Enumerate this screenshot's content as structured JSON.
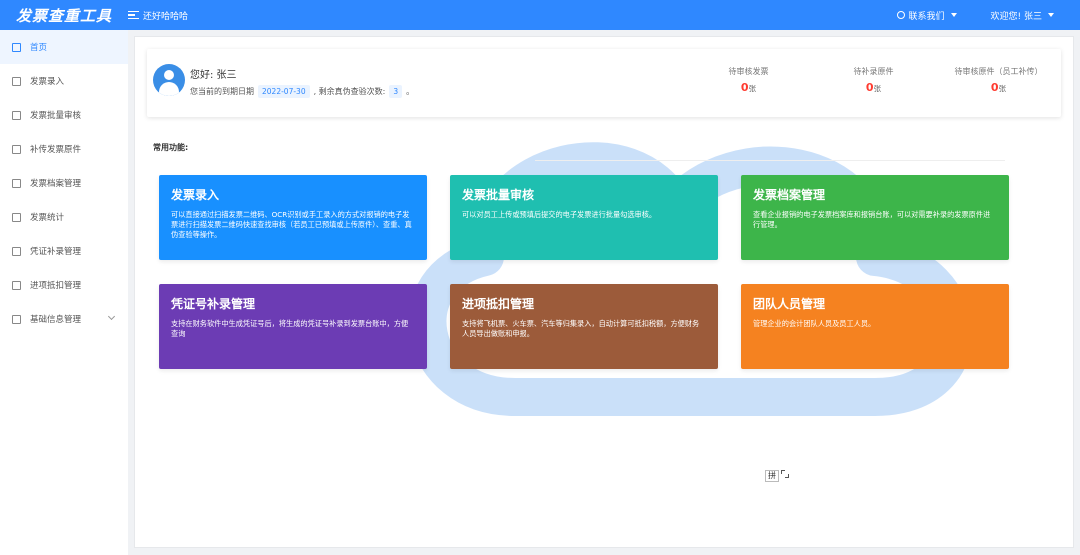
{
  "header": {
    "logo": "发票查重工具",
    "menu_label": "还好哈哈哈",
    "contact_label": "联系我们",
    "welcome_label": "欢迎您! 张三"
  },
  "sidebar": {
    "items": [
      {
        "label": "首页",
        "icon": "home-icon"
      },
      {
        "label": "发票录入",
        "icon": "entry-icon"
      },
      {
        "label": "发票批量审核",
        "icon": "batch-icon"
      },
      {
        "label": "补传发票原件",
        "icon": "upload-icon"
      },
      {
        "label": "发票档案管理",
        "icon": "archive-icon"
      },
      {
        "label": "发票统计",
        "icon": "stats-icon"
      },
      {
        "label": "凭证补录管理",
        "icon": "voucher-icon"
      },
      {
        "label": "进项抵扣管理",
        "icon": "deduct-icon"
      },
      {
        "label": "基础信息管理",
        "icon": "org-icon"
      }
    ]
  },
  "profile": {
    "greeting": "您好: 张三",
    "expiry_prefix": "您当前的到期日期",
    "expiry_date": "2022-07-30",
    "remaining_prefix": ", 剩余真伪查验次数:",
    "remaining_count": "3",
    "remaining_suffix": "。"
  },
  "stats": [
    {
      "label": "待审核发票",
      "value": "0",
      "unit": "张"
    },
    {
      "label": "待补录原件",
      "value": "0",
      "unit": "张"
    },
    {
      "label": "待审核原件（员工补传）",
      "value": "0",
      "unit": "张"
    }
  ],
  "section_title": "常用功能:",
  "cards": [
    {
      "title": "发票录入",
      "desc": "可以直接通过扫描发票二维码、OCR识别或手工录入的方式对报销的电子发票进行扫描发票二维码快速查找审核（若员工已预填或上传原件）、查重、真伪查验等操作。",
      "color": "#1890ff"
    },
    {
      "title": "发票批量审核",
      "desc": "可以对员工上传或预填后提交的电子发票进行批量勾选审核。",
      "color": "#1fbfb0"
    },
    {
      "title": "发票档案管理",
      "desc": "查看企业报销的电子发票档案库和报销台账，可以对需要补录的发票原件进行管理。",
      "color": "#3db54a"
    },
    {
      "title": "凭证号补录管理",
      "desc": "支持在财务软件中生成凭证号后，将生成的凭证号补录到发票台账中，方便查询",
      "color": "#6c3cb4"
    },
    {
      "title": "进项抵扣管理",
      "desc": "支持将飞机票、火车票、汽车等归集录入，自动计算可抵扣税额，方便财务人员导出做账和申报。",
      "color": "#9c5b3a"
    },
    {
      "title": "团队人员管理",
      "desc": "管理企业的会计团队人员及员工人员。",
      "color": "#f58220"
    }
  ],
  "mini": {
    "box_label": "拼"
  }
}
